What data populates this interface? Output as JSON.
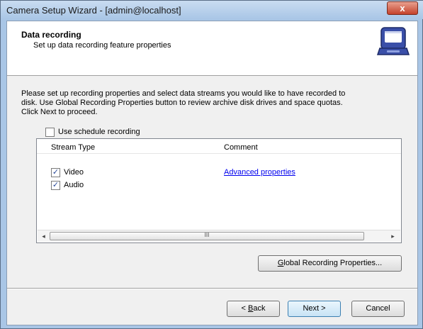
{
  "window": {
    "title": "Camera Setup Wizard - [admin@localhost]",
    "close_glyph": "x"
  },
  "header": {
    "title": "Data recording",
    "subtitle": "Set up data recording feature properties",
    "icon": "recorder-case-icon"
  },
  "intro": {
    "line1": "Please set up recording properties and select data streams you would like to have recorded to",
    "line2": "disk. Use Global Recording Properties button to review archive disk drives and space quotas.",
    "line3": "Click Next to proceed."
  },
  "schedule": {
    "label": "Use schedule recording",
    "checked": false
  },
  "streams": {
    "columns": [
      "Stream Type",
      "Comment"
    ],
    "rows": [
      {
        "type": "Video",
        "checked": true,
        "comment": "Advanced properties"
      },
      {
        "type": "Audio",
        "checked": true,
        "comment": ""
      }
    ],
    "scroll_left": "◂",
    "scroll_right": "▸",
    "scroll_grip": "III"
  },
  "buttons": {
    "global_pre": "",
    "global_underlined": "G",
    "global_post": "lobal Recording Properties...",
    "back_pre": "< ",
    "back_underlined": "B",
    "back_post": "ack",
    "next": "Next >",
    "cancel": "Cancel"
  },
  "check_glyph": "✓"
}
